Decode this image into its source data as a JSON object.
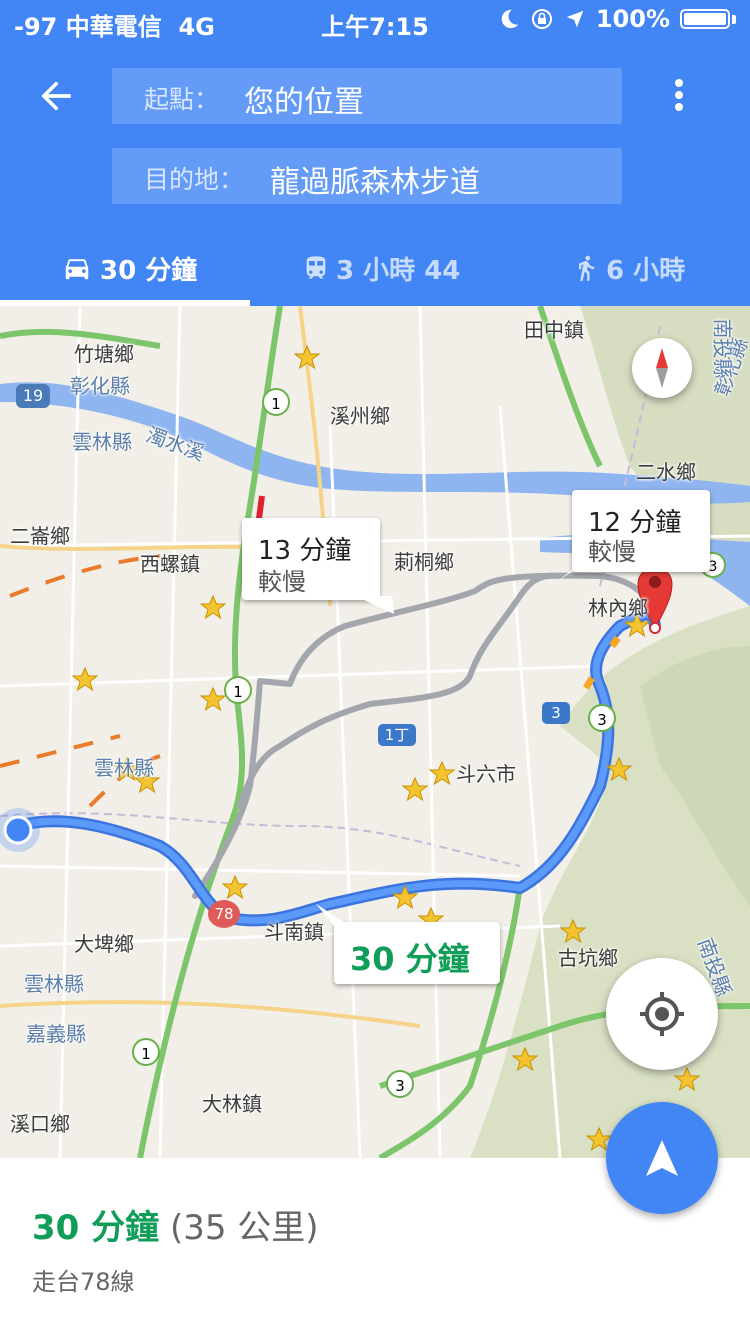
{
  "status_bar": {
    "signal": "-97 中華電信",
    "network": "4G",
    "time": "上午7:15",
    "battery": "100%"
  },
  "search": {
    "origin_label": "起點：",
    "origin_value": "您的位置",
    "destination_label": "目的地：",
    "destination_value": "龍過脈森林步道"
  },
  "tabs": [
    {
      "label": "30 分鐘",
      "icon": "car-icon",
      "selected": true
    },
    {
      "label": "3 小時 44",
      "icon": "train-icon",
      "selected": false
    },
    {
      "label": "6 小時",
      "icon": "walk-icon",
      "selected": false
    }
  ],
  "map": {
    "places": [
      "竹塘鄉",
      "彰化縣",
      "雲林縣",
      "濁水溪",
      "溪州鄉",
      "田中鎮",
      "二水鄉",
      "二崙鄉",
      "西螺鎮",
      "莿桐鄉",
      "林內鄉",
      "雲林縣",
      "斗六市",
      "大埤鄉",
      "斗南鎮",
      "古坑鄉",
      "雲林縣",
      "嘉義縣",
      "大林鎮",
      "溪口鄉",
      "彰化縣",
      "南投縣",
      "南投縣"
    ],
    "shields": [
      "19",
      "1",
      "1",
      "1丁",
      "3",
      "3",
      "78",
      "1",
      "3",
      "3"
    ],
    "callouts": [
      {
        "time": "13 分鐘",
        "note": "較慢"
      },
      {
        "time": "12 分鐘",
        "note": "較慢"
      },
      {
        "time": "30 分鐘"
      }
    ]
  },
  "summary": {
    "duration": "30 分鐘",
    "distance": "(35 公里)",
    "via": "走台78線"
  },
  "colors": {
    "primary": "#4285f4",
    "route": "#4a87f0",
    "green": "#0f9d58",
    "alt_route": "#a3a7ad"
  }
}
